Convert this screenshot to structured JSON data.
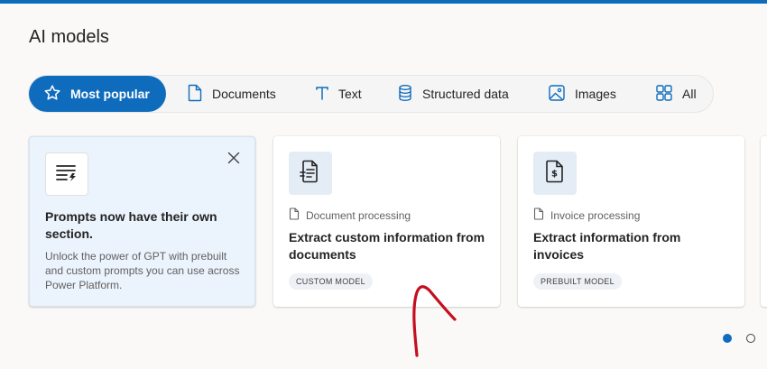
{
  "header": {
    "title": "AI models"
  },
  "filters": [
    {
      "label": "Most popular",
      "icon": "star-icon",
      "active": true
    },
    {
      "label": "Documents",
      "icon": "document-icon",
      "active": false
    },
    {
      "label": "Text",
      "icon": "text-icon",
      "active": false
    },
    {
      "label": "Structured data",
      "icon": "database-icon",
      "active": false
    },
    {
      "label": "Images",
      "icon": "image-icon",
      "active": false
    },
    {
      "label": "All",
      "icon": "grid-icon",
      "active": false
    }
  ],
  "promo": {
    "title": "Prompts now have their own section.",
    "description": "Unlock the power of GPT with prebuilt and custom prompts you can use across Power Platform."
  },
  "cards": [
    {
      "category": "Document processing",
      "title": "Extract custom information from documents",
      "badge": "CUSTOM MODEL"
    },
    {
      "category": "Invoice processing",
      "title": "Extract information from invoices",
      "badge": "PREBUILT MODEL"
    }
  ],
  "pagination": {
    "pages": 2,
    "current": 1
  },
  "colors": {
    "accent": "#0f6cbd",
    "background": "#faf9f8",
    "promo_bg": "#ebf3fc",
    "annotation": "#c50f1f"
  }
}
